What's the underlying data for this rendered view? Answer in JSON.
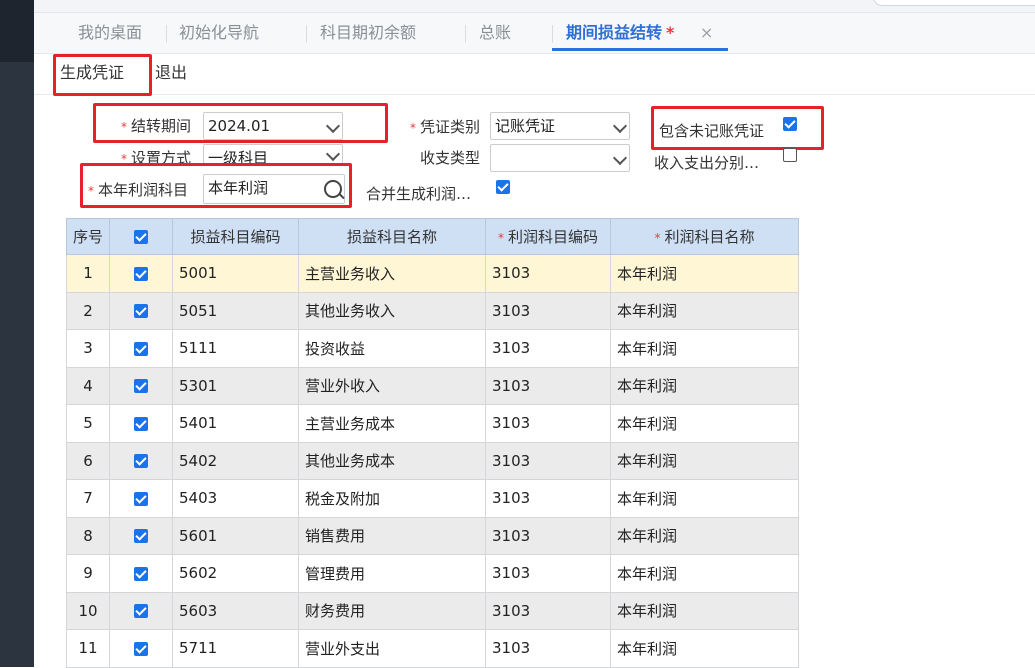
{
  "tabs": [
    {
      "label": "我的桌面",
      "active": false
    },
    {
      "label": "初始化导航",
      "active": false
    },
    {
      "label": "科目期初余额",
      "active": false
    },
    {
      "label": "总账",
      "active": false
    },
    {
      "label": "期间损益结转",
      "active": true,
      "modified_mark": "*"
    }
  ],
  "tab_close_glyph": "×",
  "toolbar": {
    "generate_label": "生成凭证",
    "exit_label": "退出"
  },
  "form": {
    "required_mark": "*",
    "period_label": "结转期间",
    "period_value": "2024.01",
    "setting_label": "设置方式",
    "setting_value": "一级科目",
    "profit_subject_label": "本年利润科目",
    "profit_subject_value": "本年利润",
    "voucher_type_label": "凭证类别",
    "voucher_type_value": "记账凭证",
    "income_type_label": "收支类型",
    "income_type_value": "",
    "include_unposted_label": "包含未记账凭证",
    "include_unposted_checked": true,
    "split_income_label": "收入支出分别…",
    "split_income_checked": false,
    "merge_generate_label": "合并生成利润…",
    "merge_generate_checked": true
  },
  "table": {
    "headers": {
      "index": "序号",
      "pl_code": "损益科目编码",
      "pl_name": "损益科目名称",
      "profit_code": "利润科目编码",
      "profit_name": "利润科目名称"
    },
    "rows": [
      {
        "index": "1",
        "pl_code": "5001",
        "pl_name": "主营业务收入",
        "profit_code": "3103",
        "profit_name": "本年利润"
      },
      {
        "index": "2",
        "pl_code": "5051",
        "pl_name": "其他业务收入",
        "profit_code": "3103",
        "profit_name": "本年利润"
      },
      {
        "index": "3",
        "pl_code": "5111",
        "pl_name": "投资收益",
        "profit_code": "3103",
        "profit_name": "本年利润"
      },
      {
        "index": "4",
        "pl_code": "5301",
        "pl_name": "营业外收入",
        "profit_code": "3103",
        "profit_name": "本年利润"
      },
      {
        "index": "5",
        "pl_code": "5401",
        "pl_name": "主营业务成本",
        "profit_code": "3103",
        "profit_name": "本年利润"
      },
      {
        "index": "6",
        "pl_code": "5402",
        "pl_name": "其他业务成本",
        "profit_code": "3103",
        "profit_name": "本年利润"
      },
      {
        "index": "7",
        "pl_code": "5403",
        "pl_name": "税金及附加",
        "profit_code": "3103",
        "profit_name": "本年利润"
      },
      {
        "index": "8",
        "pl_code": "5601",
        "pl_name": "销售费用",
        "profit_code": "3103",
        "profit_name": "本年利润"
      },
      {
        "index": "9",
        "pl_code": "5602",
        "pl_name": "管理费用",
        "profit_code": "3103",
        "profit_name": "本年利润"
      },
      {
        "index": "10",
        "pl_code": "5603",
        "pl_name": "财务费用",
        "profit_code": "3103",
        "profit_name": "本年利润"
      },
      {
        "index": "11",
        "pl_code": "5711",
        "pl_name": "营业外支出",
        "profit_code": "3103",
        "profit_name": "本年利润"
      }
    ]
  },
  "colors": {
    "accent": "#2f6fd6",
    "required": "#e03c3c",
    "annotation": "#e8202a",
    "checkbox": "#1a73e8",
    "header_bg": "#cfe0f5",
    "highlight_row": "#fff6d6"
  }
}
